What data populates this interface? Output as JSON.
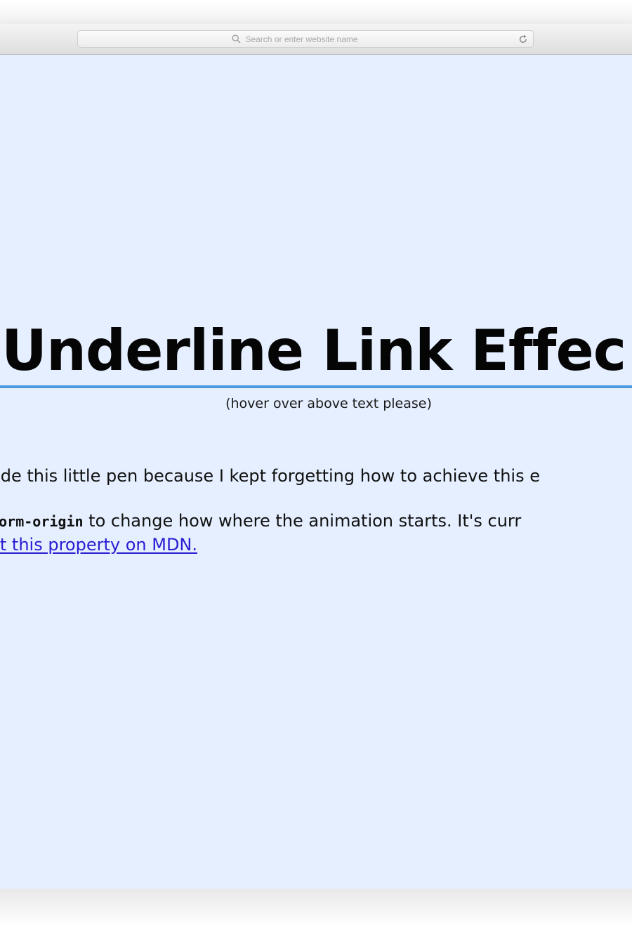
{
  "browser": {
    "address_placeholder": "Search or enter website name",
    "search_icon": "search-icon",
    "reload_icon": "reload-icon"
  },
  "page": {
    "heading": "Underline Link Effec",
    "hover_hint": "(hover over above text please)",
    "paragraph_1": "ade this little pen because I kept forgetting how to achieve this e",
    "paragraph_2_code": "nsform-origin",
    "paragraph_2_text": " to change how where the animation starts. It's curr",
    "link_text": "out this property on MDN."
  },
  "colors": {
    "page_background": "#e5efff",
    "underline_accent": "#4b9be0",
    "link": "#2a1cd3"
  }
}
